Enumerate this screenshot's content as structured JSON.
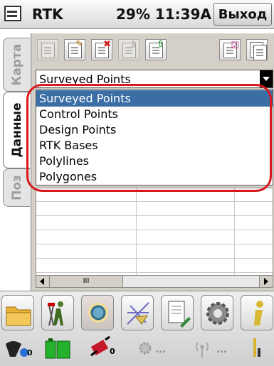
{
  "titlebar": {
    "app_name": "RTK",
    "status": "29% 11:39A",
    "exit_label": "Выход"
  },
  "tabs": [
    {
      "label": "Карта",
      "active": false
    },
    {
      "label": "Данные",
      "active": true
    },
    {
      "label": "Поз",
      "active": false
    }
  ],
  "combo": {
    "selected": "Surveyed Points"
  },
  "dropdown": {
    "items": [
      "Surveyed Points",
      "Control Points",
      "Design Points",
      "RTK Bases",
      "Polylines",
      "Polygones"
    ],
    "selected_index": 0
  },
  "scrollbar": {
    "thumb_label": "III"
  },
  "status_icons": [
    {
      "name": "signal-icon",
      "value": "0"
    },
    {
      "name": "battery-icon",
      "value": ""
    },
    {
      "name": "satellite-icon",
      "value": "0"
    },
    {
      "name": "gear-status-icon",
      "value": "..."
    },
    {
      "name": "radio-icon",
      "value": "..."
    },
    {
      "name": "bars-icon",
      "value": ""
    }
  ],
  "colors": {
    "highlight": "#d8181c",
    "selection": "#3a6ea5"
  }
}
